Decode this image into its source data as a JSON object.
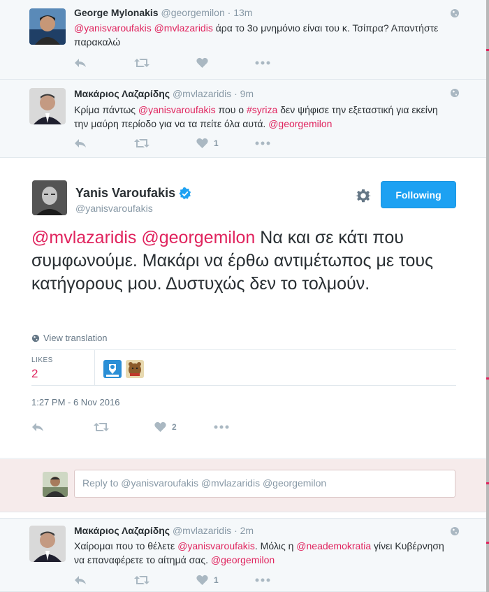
{
  "tweets_above": [
    {
      "fullname": "George Mylonakis",
      "username": "@georgemilon",
      "time": "13m",
      "text_parts": [
        {
          "t": "@yanisvaroufakis",
          "m": true
        },
        {
          "t": " ",
          "m": false
        },
        {
          "t": "@mvlazaridis",
          "m": true
        },
        {
          "t": " άρα το 3ο μνημόνιο είναι του κ. Τσίπρα? Απαντήστε παρακαλώ",
          "m": false
        }
      ],
      "like_count": ""
    },
    {
      "fullname": "Μακάριος Λαζαρίδης",
      "username": "@mvlazaridis",
      "time": "9m",
      "text_parts": [
        {
          "t": "Κρίμα πάντως ",
          "m": false
        },
        {
          "t": "@yanisvaroufakis",
          "m": true
        },
        {
          "t": " που ο ",
          "m": false
        },
        {
          "t": "#syriza",
          "m": true
        },
        {
          "t": " δεν ψήφισε την εξεταστική για εκείνη την μαύρη περίοδο για να τα πείτε όλα αυτά. ",
          "m": false
        },
        {
          "t": "@georgemilon",
          "m": true
        }
      ],
      "like_count": "1"
    }
  ],
  "main_tweet": {
    "fullname": "Yanis Varoufakis",
    "username": "@yanisvaroufakis",
    "follow_label": "Following",
    "text_parts": [
      {
        "t": "@mvlazaridis",
        "m": true
      },
      {
        "t": " ",
        "m": false
      },
      {
        "t": "@georgemilon",
        "m": true
      },
      {
        "t": " Να και σε κάτι που συμφωνούμε. Μακάρι να έρθω αντιμέτωπος με τους κατήγορους μου. Δυστυχώς δεν το τολμούν.",
        "m": false
      }
    ],
    "translate_label": "View translation",
    "likes_label": "LIKES",
    "likes_value": "2",
    "timestamp": "1:27 PM - 6 Nov 2016",
    "like_count": "2"
  },
  "reply": {
    "placeholder": "Reply to @yanisvaroufakis @mvlazaridis @georgemilon"
  },
  "tweets_below": [
    {
      "fullname": "Μακάριος Λαζαρίδης",
      "username": "@mvlazaridis",
      "time": "2m",
      "text_parts": [
        {
          "t": "Χαίρομαι που το θέλετε ",
          "m": false
        },
        {
          "t": "@yanisvaroufakis",
          "m": true
        },
        {
          "t": ". Μόλις η ",
          "m": false
        },
        {
          "t": "@neademokratia",
          "m": true
        },
        {
          "t": " γίνει Κυβέρνηση να επαναφέρετε το αίτημά σας.  ",
          "m": false
        },
        {
          "t": "@georgemilon",
          "m": true
        }
      ],
      "like_count": "1"
    }
  ],
  "colors": {
    "accent": "#1da1f2",
    "link": "#e0245e",
    "muted": "#8899a6",
    "reply_bg": "#f6ebeb"
  }
}
